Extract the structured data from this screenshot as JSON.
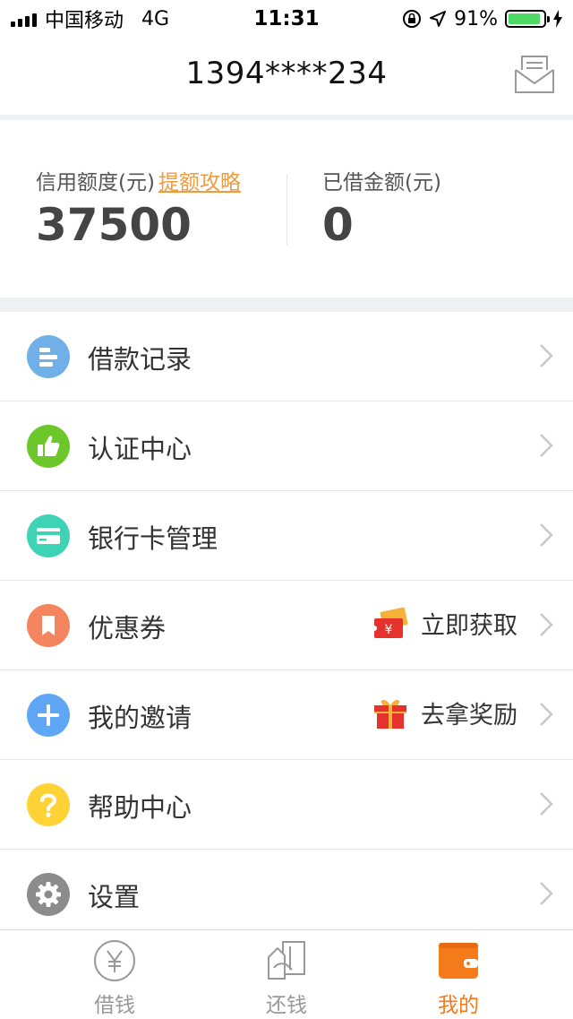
{
  "status_bar": {
    "carrier": "中国移动",
    "network": "4G",
    "time": "11:31",
    "battery": "91%",
    "battery_level": 0.91
  },
  "header": {
    "title": "1394****234",
    "mail_icon": "envelope-icon"
  },
  "summary": {
    "credit_label": "信用额度(元)",
    "credit_link": "提额攻略",
    "credit_value": "37500",
    "borrowed_label": "已借金额(元)",
    "borrowed_value": "0"
  },
  "menu": [
    {
      "label": "借款记录",
      "icon": "list-icon",
      "color": "#6fb0e8"
    },
    {
      "label": "认证中心",
      "icon": "thumbs-up-icon",
      "color": "#6cc82a"
    },
    {
      "label": "银行卡管理",
      "icon": "card-icon",
      "color": "#3fd3b6"
    },
    {
      "label": "优惠券",
      "icon": "bookmark-icon",
      "color": "#f5855e",
      "extra": "立即获取",
      "extra_icon": "coupon-ticket-icon"
    },
    {
      "label": "我的邀请",
      "icon": "plus-icon",
      "color": "#5fa6f5",
      "extra": "去拿奖励",
      "extra_icon": "gift-icon"
    },
    {
      "label": "帮助中心",
      "icon": "question-icon",
      "color": "#ffd335"
    },
    {
      "label": "设置",
      "icon": "gear-icon",
      "color": "#8c8c8c"
    }
  ],
  "tabbar": {
    "tabs": [
      {
        "label": "借钱",
        "icon": "yen-coin-icon"
      },
      {
        "label": "还钱",
        "icon": "repay-icon"
      },
      {
        "label": "我的",
        "icon": "wallet-icon"
      }
    ],
    "active_color": "#f57a1a",
    "inactive_color": "#999999"
  }
}
